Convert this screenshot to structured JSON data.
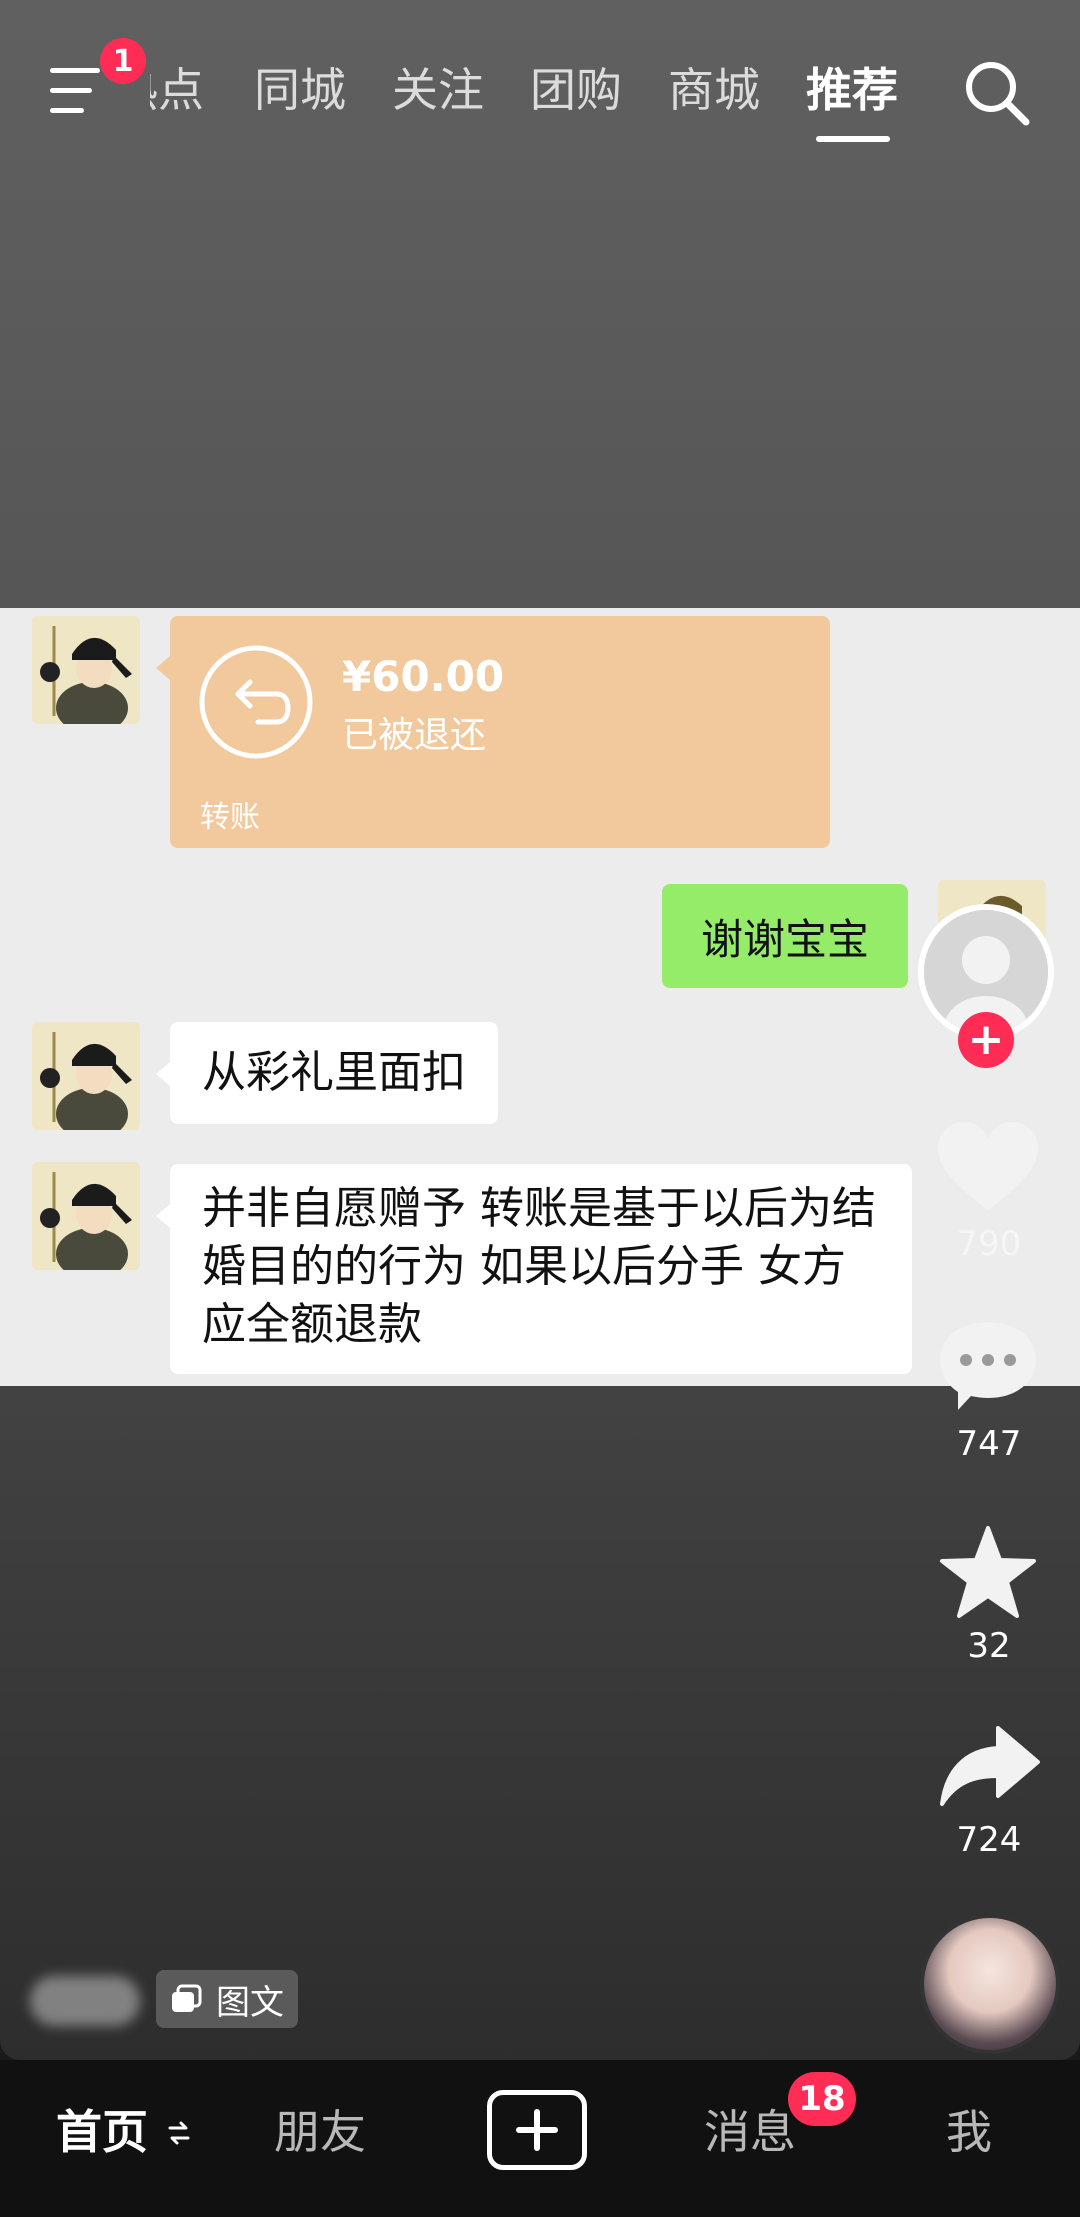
{
  "header": {
    "menu_badge": "1",
    "tabs": [
      {
        "label": "热点",
        "active": false
      },
      {
        "label": "同城",
        "active": false
      },
      {
        "label": "关注",
        "active": false
      },
      {
        "label": "团购",
        "active": false
      },
      {
        "label": "商城",
        "active": false
      },
      {
        "label": "推荐",
        "active": true
      }
    ],
    "search_icon": "search-icon"
  },
  "post": {
    "chat": {
      "transfer": {
        "amount": "¥60.00",
        "status": "已被退还",
        "label": "转账"
      },
      "messages": [
        {
          "side": "right",
          "text": "谢谢宝宝"
        },
        {
          "side": "left",
          "text": "从彩礼里面扣"
        },
        {
          "side": "left",
          "text": "并非自愿赠予 转账是基于以后为结婚目的的行为 如果以后分手 女方应全额退款"
        }
      ]
    },
    "type_chip": "图文"
  },
  "actions": {
    "likes": "790",
    "comments": "747",
    "favorites": "32",
    "shares": "724",
    "follow_symbol": "+"
  },
  "bottom_nav": {
    "home": "首页",
    "friends": "朋友",
    "messages": "消息",
    "messages_badge": "18",
    "me": "我"
  },
  "colors": {
    "accent": "#ff2d55",
    "transfer_bubble": "#f2c99c",
    "sent_bubble": "#95ec69"
  }
}
